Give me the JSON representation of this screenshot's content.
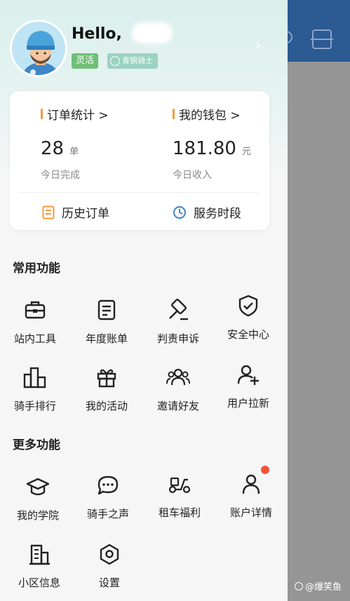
{
  "colors": {
    "accent_orange": "#f39a3a",
    "accent_blue": "#3d84c6",
    "chip_green": "#6fbf76",
    "chip_teal": "#9bd2c0",
    "notification_red": "#f0533a",
    "header_blue": "#2c5a93"
  },
  "profile": {
    "greeting": "Hello,",
    "rider_type": "灵活",
    "rider_level": "青铜骑士"
  },
  "stats": {
    "orders": {
      "title": "订单统计 >",
      "value": "28",
      "unit": "单",
      "subtitle": "今日完成"
    },
    "wallet": {
      "title": "我的钱包 >",
      "value": "181.80",
      "unit": "元",
      "subtitle": "今日收入"
    },
    "links": {
      "history": "历史订单",
      "service_hours": "服务时段"
    }
  },
  "common_functions": {
    "title": "常用功能",
    "items": [
      {
        "label": "站内工具",
        "icon": "toolbox-icon"
      },
      {
        "label": "年度账单",
        "icon": "bill-icon"
      },
      {
        "label": "判责申诉",
        "icon": "gavel-icon"
      },
      {
        "label": "安全中心",
        "icon": "shield-check-icon"
      },
      {
        "label": "骑手排行",
        "icon": "ranking-icon"
      },
      {
        "label": "我的活动",
        "icon": "gift-icon"
      },
      {
        "label": "邀请好友",
        "icon": "friends-icon"
      },
      {
        "label": "用户拉新",
        "icon": "add-user-icon"
      }
    ]
  },
  "more_functions": {
    "title": "更多功能",
    "items": [
      {
        "label": "我的学院",
        "icon": "graduation-cap-icon"
      },
      {
        "label": "骑手之声",
        "icon": "chat-bubble-icon"
      },
      {
        "label": "租车福利",
        "icon": "scooter-icon"
      },
      {
        "label": "账户详情",
        "icon": "person-icon"
      },
      {
        "label": "小区信息",
        "icon": "building-icon"
      },
      {
        "label": "设置",
        "icon": "settings-hexagon-icon"
      }
    ]
  },
  "watermark": "@爆笑鱼"
}
